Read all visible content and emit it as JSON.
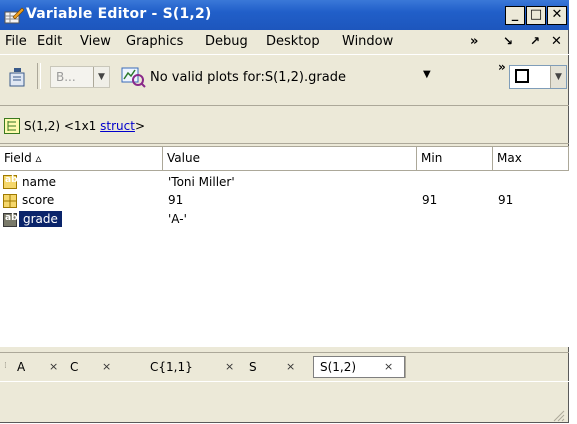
{
  "window": {
    "title": "Variable Editor - S(1,2)"
  },
  "title_buttons": {
    "minimize": "_",
    "maximize": "□",
    "close": "✕"
  },
  "menu": {
    "items": [
      "File",
      "Edit",
      "View",
      "Graphics",
      "Debug",
      "Desktop",
      "Window"
    ],
    "overflow": "»",
    "dock": "↘",
    "undock": "↗",
    "close": "✕"
  },
  "toolbar": {
    "base_combo": "B...",
    "plot_text": "No valid plots for:S(1,2).grade",
    "overflow": "»"
  },
  "path": {
    "var": "S(1,2) <1x1 ",
    "link": "struct",
    "tail": ">"
  },
  "grid": {
    "columns": [
      "Field ▵",
      "Value",
      "Min",
      "Max"
    ],
    "rows": [
      {
        "icon": "char-icon",
        "field": "name",
        "value": "'Toni Miller'",
        "min": "",
        "max": ""
      },
      {
        "icon": "numeric-icon",
        "field": "score",
        "value": "91",
        "min": "91",
        "max": "91"
      },
      {
        "icon": "char-icon",
        "field": "grade",
        "value": "'A-'",
        "min": "",
        "max": ""
      }
    ]
  },
  "tabs": [
    "A",
    "C",
    "C{1,1}",
    "S",
    "S(1,2)"
  ],
  "tab_close": "×",
  "colors": {
    "title_bar": "#215fc9",
    "chrome": "#ece9d8",
    "selection": "#0a246a",
    "link": "#0000cc"
  }
}
